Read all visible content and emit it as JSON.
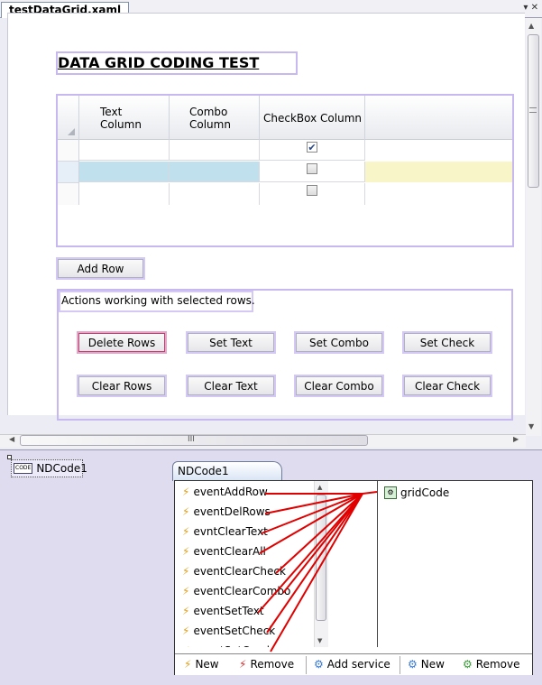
{
  "tab": {
    "title": "testDataGrid.xaml",
    "menu_glyph": "▾ ✕"
  },
  "designer": {
    "title": "DATA GRID CODING TEST",
    "grid": {
      "columns": [
        "Text Column",
        "Combo Column",
        "CheckBox Column"
      ],
      "column_lines": [
        [
          "Text",
          "Column"
        ],
        [
          "Combo",
          "Column"
        ],
        [
          "CheckBox Column"
        ]
      ],
      "rows": [
        {
          "checked": true,
          "selected": false
        },
        {
          "checked": false,
          "selected": true
        },
        {
          "checked": false,
          "selected": false
        }
      ]
    },
    "add_row_label": "Add Row",
    "actions_label": "Actions working with selected rows.",
    "buttons_row1": [
      "Delete Rows",
      "Set Text",
      "Set Combo",
      "Set Check"
    ],
    "buttons_row2": [
      "Clear Rows",
      "Clear Text",
      "Clear Combo",
      "Clear Check"
    ],
    "hscroll_glyph": "III"
  },
  "component": {
    "icon_text": "CODE",
    "name": "NDCode1"
  },
  "ndcode": {
    "tab_label": "NDCode1",
    "events": [
      "eventAddRow",
      "eventDelRows",
      "evntClearText",
      "eventClearAll",
      "eventClearCheck",
      "eventClearCombo",
      "eventSetText",
      "eventSetCheck",
      "eventSetCombo"
    ],
    "service": "gridCode",
    "bottom": {
      "new1": "New",
      "remove1": "Remove",
      "add_service": "Add service",
      "new2": "New",
      "remove2": "Remove"
    }
  },
  "colors": {
    "selected_row": "#bfe0ec",
    "highlight_cell": "#f8f6c8",
    "link_line": "#e00000",
    "selection_border": "#c8b8f0"
  }
}
